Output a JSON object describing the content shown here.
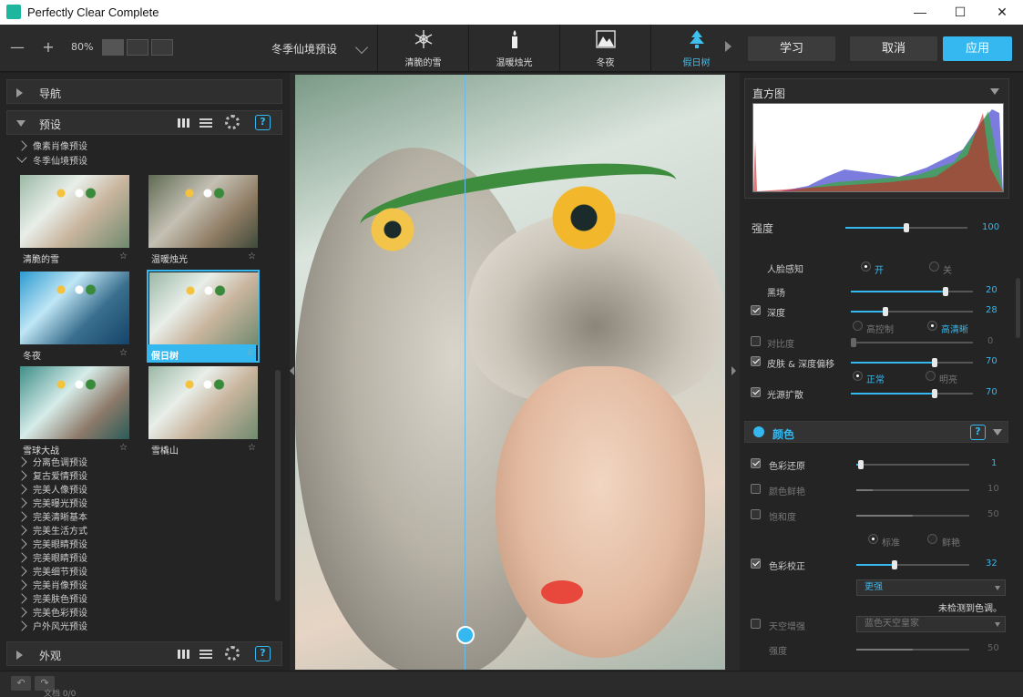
{
  "window": {
    "title": "Perfectly Clear Complete",
    "minimize": "—",
    "maximize": "☐",
    "close": "✕"
  },
  "toolbar": {
    "zoom_out": "—",
    "zoom_in": "+",
    "zoom": "80%",
    "preset_select": "冬季仙境预设",
    "strip": [
      {
        "label": "清脆的雪",
        "icon": "snowflake-icon"
      },
      {
        "label": "温暖烛光",
        "icon": "candle-icon"
      },
      {
        "label": "冬夜",
        "icon": "mountain-icon"
      },
      {
        "label": "假日树",
        "icon": "tree-icon"
      }
    ],
    "learn": "学习",
    "cancel": "取消",
    "apply": "应用"
  },
  "left": {
    "nav_title": "导航",
    "preset_title": "预设",
    "help": "?",
    "tree_top": [
      "像素肖像预设",
      "冬季仙境预设"
    ],
    "thumbs": [
      {
        "label": "清脆的雪",
        "star": "☆"
      },
      {
        "label": "温暖烛光",
        "star": "☆"
      },
      {
        "label": "冬夜",
        "star": "☆"
      },
      {
        "label": "假日树",
        "star": "☆"
      },
      {
        "label": "雪球大战",
        "star": "☆"
      },
      {
        "label": "雪橇山",
        "star": "☆"
      }
    ],
    "tree_bottom": [
      "分离色调预设",
      "复古爱情预设",
      "完美人像预设",
      "完美曝光预设",
      "完美清晰基本",
      "完美生活方式",
      "完美眼睛预设",
      "完美眼睛预设",
      "完美细节预设",
      "完美肖像预设",
      "完美肤色预设",
      "完美色彩预设",
      "户外风光预设"
    ],
    "appearance_title": "外观"
  },
  "right": {
    "histogram_title": "直方图",
    "strength_label": "强度",
    "strength_value": "100",
    "rows": {
      "face_detect": "人脸感知",
      "on": "开",
      "off": "关",
      "light": "黑场",
      "light_val": "20",
      "depth": "深度",
      "depth_val": "28",
      "high_ctrl": "高控制",
      "high_clear": "高清晰",
      "contrast": "对比度",
      "contrast_val": "0",
      "skin": "皮肤 & 深度偏移",
      "skin_val": "70",
      "normal": "正常",
      "bright": "明亮",
      "diffuse": "光源扩散",
      "diffuse_val": "70"
    },
    "color_title": "颜色",
    "color_help": "?",
    "crows": {
      "restore": "色彩还原",
      "restore_val": "1",
      "vibrancy": "颜色鲜艳",
      "vibrancy_val": "10",
      "saturation": "饱和度",
      "saturation_val": "50",
      "standard": "标准",
      "vivid": "鲜艳",
      "correct": "色彩校正",
      "correct_val": "32",
      "correct_mode": "更强",
      "no_cast": "未检测到色调。",
      "sky": "天空增强",
      "sky_mode": "蓝色天空皇家",
      "sky_strength": "强度",
      "sky_strength_val": "50"
    }
  },
  "status": {
    "undo": "↶",
    "redo": "↷",
    "text": "文档 0/0"
  },
  "colors": {
    "accent": "#35b8ef",
    "panel": "#242424",
    "toolbar": "#2b2b2b"
  }
}
